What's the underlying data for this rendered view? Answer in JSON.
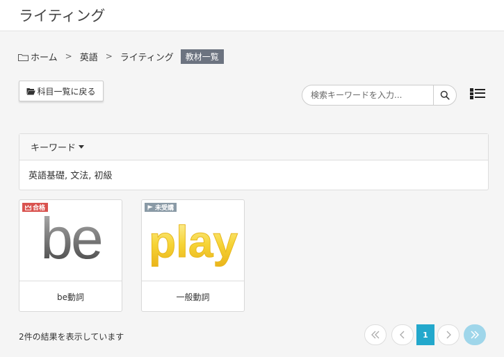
{
  "header": {
    "title": "ライティング"
  },
  "breadcrumb": {
    "items": [
      "ホーム",
      "英語",
      "ライティング"
    ],
    "separator": ">",
    "current": "教材一覧"
  },
  "back_button": {
    "label": "科目一覧に戻る",
    "icon": "folder-open-icon"
  },
  "search": {
    "placeholder": "検索キーワードを入力...",
    "value": "",
    "icon": "search-icon"
  },
  "view_toggle": {
    "icon": "list-view-icon"
  },
  "keyword_panel": {
    "title": "キーワード",
    "keywords": "英語基礎, 文法, 初級"
  },
  "cards": [
    {
      "title": "be動詞",
      "thumbnail_text": "be",
      "badge": "合格",
      "badge_icon": "crown-icon",
      "badge_color": "#d9534f"
    },
    {
      "title": "一般動詞",
      "thumbnail_text": "play",
      "badge": "未受講",
      "badge_icon": "flag-icon",
      "badge_color": "#8a9aa6"
    }
  ],
  "results": {
    "summary": "2件の結果を表示しています"
  },
  "pagination": {
    "current": "1",
    "accent_color": "#23a8cc"
  }
}
